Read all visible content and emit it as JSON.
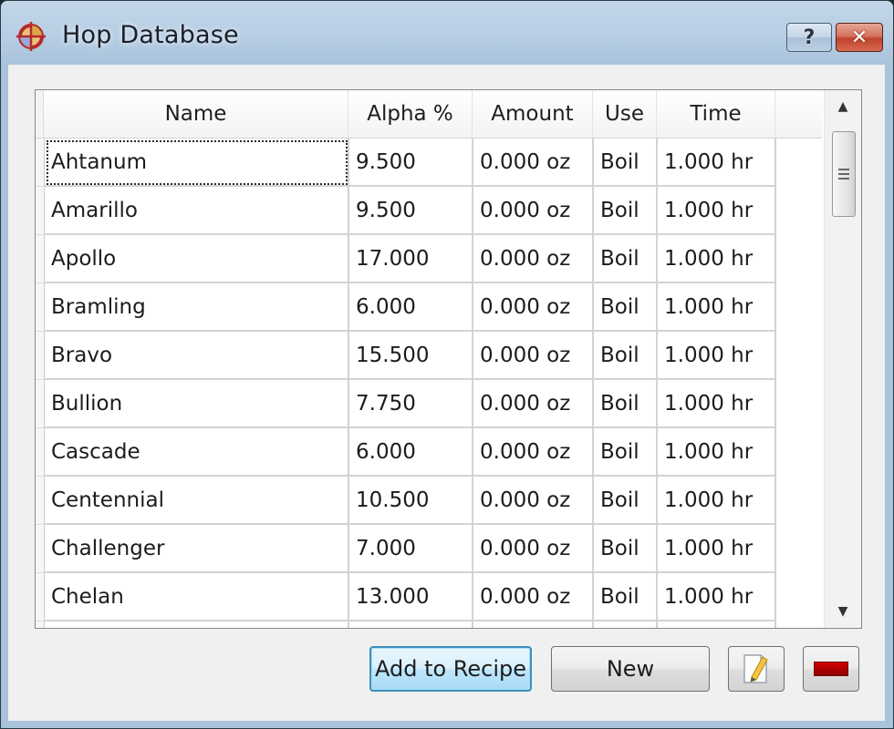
{
  "window": {
    "title": "Hop Database",
    "app_icon": "crosshair-app-icon",
    "help_button": "?",
    "close_button": "✕"
  },
  "table": {
    "columns": [
      "Name",
      "Alpha %",
      "Amount",
      "Use",
      "Time"
    ],
    "rows": [
      {
        "name": "Ahtanum",
        "alpha": "9.500",
        "amount": "0.000 oz",
        "use": "Boil",
        "time": "1.000 hr"
      },
      {
        "name": "Amarillo",
        "alpha": "9.500",
        "amount": "0.000 oz",
        "use": "Boil",
        "time": "1.000 hr"
      },
      {
        "name": "Apollo",
        "alpha": "17.000",
        "amount": "0.000 oz",
        "use": "Boil",
        "time": "1.000 hr"
      },
      {
        "name": "Bramling",
        "alpha": "6.000",
        "amount": "0.000 oz",
        "use": "Boil",
        "time": "1.000 hr"
      },
      {
        "name": "Bravo",
        "alpha": "15.500",
        "amount": "0.000 oz",
        "use": "Boil",
        "time": "1.000 hr"
      },
      {
        "name": "Bullion",
        "alpha": "7.750",
        "amount": "0.000 oz",
        "use": "Boil",
        "time": "1.000 hr"
      },
      {
        "name": "Cascade",
        "alpha": "6.000",
        "amount": "0.000 oz",
        "use": "Boil",
        "time": "1.000 hr"
      },
      {
        "name": "Centennial",
        "alpha": "10.500",
        "amount": "0.000 oz",
        "use": "Boil",
        "time": "1.000 hr"
      },
      {
        "name": "Challenger",
        "alpha": "7.000",
        "amount": "0.000 oz",
        "use": "Boil",
        "time": "1.000 hr"
      },
      {
        "name": "Chelan",
        "alpha": "13.000",
        "amount": "0.000 oz",
        "use": "Boil",
        "time": "1.000 hr"
      },
      {
        "name": "",
        "alpha": "",
        "amount": "",
        "use": "",
        "time": ""
      }
    ],
    "focused_row": 0
  },
  "scrollbar": {
    "up_arrow": "▲",
    "down_arrow": "▼"
  },
  "buttons": {
    "add_to_recipe": "Add to Recipe",
    "new": "New",
    "edit_icon": "edit-document-icon",
    "remove_icon": "remove-icon"
  },
  "colors": {
    "titlebar": "#b6cde3",
    "close_button": "#c1412a",
    "default_button_border": "#3c8fb9",
    "remove_red": "#b00000"
  }
}
